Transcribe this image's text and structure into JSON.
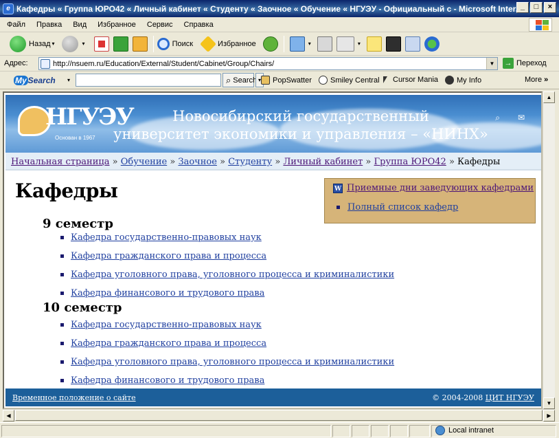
{
  "window": {
    "title": "Кафедры « Группа ЮРО42 « Личный кабинет « Студенту « Заочное « Обучение « НГУЭУ - Официальный с - Microsoft Inter...",
    "min_glyph": "_",
    "max_glyph": "□",
    "close_glyph": "×"
  },
  "menu": {
    "items": [
      "Файл",
      "Правка",
      "Вид",
      "Избранное",
      "Сервис",
      "Справка"
    ]
  },
  "toolbar": {
    "back_label": "Назад",
    "search_label": "Поиск",
    "favorites_label": "Избранное",
    "drop_glyph": "▾"
  },
  "address": {
    "label": "Адрес:",
    "url": "http://nsuem.ru/Education/External/Student/Cabinet/Group/Chairs/",
    "go_label": "Переход",
    "go_glyph": "→"
  },
  "mysearch": {
    "logo_my": "My",
    "logo_search": "Search",
    "search_button": "Search",
    "search_glyph": "⌕",
    "items": [
      "PopSwatter",
      "Smiley Central",
      "Cursor Mania",
      "My Info"
    ],
    "more": "More",
    "more_glyph": "»"
  },
  "site": {
    "logo_letters": "НГУЭУ",
    "founded": "Основан в 1967",
    "university_line1": "Новосибирский государственный",
    "university_line2": "университет экономики и управления – «НИНХ»",
    "search_glyph": "⌕",
    "mail_glyph": "✉"
  },
  "breadcrumb": {
    "items": [
      "Начальная страница",
      "Обучение",
      "Заочное",
      "Студенту",
      "Личный кабинет",
      "Группа ЮРО42"
    ],
    "current": "Кафедры",
    "separator": "»"
  },
  "page": {
    "title": "Кафедры"
  },
  "sidebox": {
    "word_icon": "W",
    "link1": "Приемные дни заведующих кафедрами",
    "link2": "Полный список кафедр"
  },
  "semesters": [
    {
      "title": "9 семестр",
      "departments": [
        "Кафедра государственно-правовых наук",
        "Кафедра гражданского права и процесса",
        "Кафедра уголовного права, уголовного процесса и криминалистики",
        "Кафедра финансового и трудового права"
      ]
    },
    {
      "title": "10 семестр",
      "departments": [
        "Кафедра государственно-правовых наук",
        "Кафедра гражданского права и процесса",
        "Кафедра уголовного права, уголовного процесса и криминалистики",
        "Кафедра финансового и трудового права"
      ]
    }
  ],
  "footer": {
    "left_link": "Временное положение о сайте",
    "copyright": "© 2004-2008",
    "right_link": "ЦИТ НГУЭУ"
  },
  "scroll": {
    "up": "▲",
    "down": "▼",
    "left": "◀",
    "right": "▶"
  },
  "status": {
    "zone": "Local intranet"
  },
  "colors": {
    "title_bar": "#0a246a",
    "banner": "#2f6fb6",
    "breadcrumb_bg": "#e4eef7",
    "sidebox_bg": "#d6b479",
    "footer_bg": "#1c5f9a",
    "link_blue": "#1f3f9f",
    "link_visited": "#4c1577"
  }
}
